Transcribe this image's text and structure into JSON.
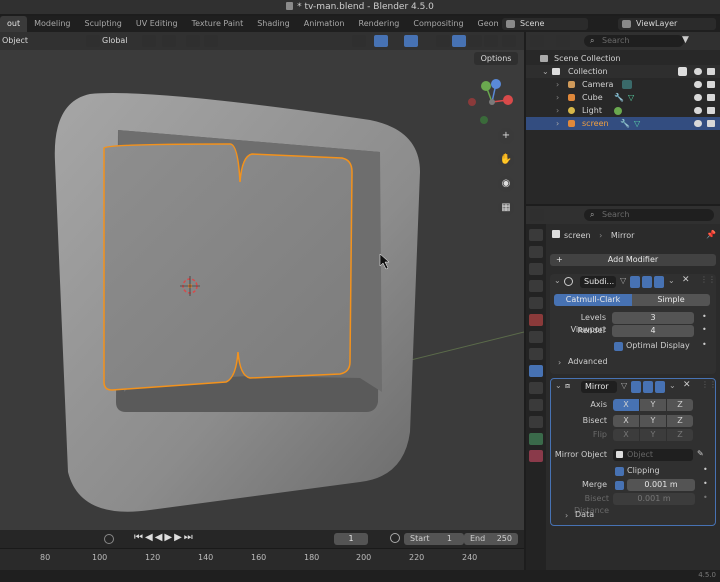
{
  "window": {
    "title": "* tv-man.blend - Blender 4.5.0"
  },
  "workspace_tabs": [
    "out",
    "Modeling",
    "Sculpting",
    "UV Editing",
    "Texture Paint",
    "Shading",
    "Animation",
    "Rendering",
    "Compositing",
    "Geometry Nodes",
    "Sc"
  ],
  "scene": {
    "name": "Scene",
    "view_layer": "ViewLayer"
  },
  "viewport": {
    "mode": "Object",
    "orientation": "Global",
    "options_label": "Options"
  },
  "timeline": {
    "current_frame": "1",
    "start_label": "Start",
    "start": "1",
    "end_label": "End",
    "end": "250",
    "ruler": [
      "80",
      "100",
      "120",
      "140",
      "160",
      "180",
      "200",
      "220",
      "240"
    ]
  },
  "version": "4.5.0",
  "outliner": {
    "search_placeholder": "Search",
    "scene_collection": "Scene Collection",
    "collection": "Collection",
    "items": [
      {
        "name": "Camera",
        "color": "#d09a5a"
      },
      {
        "name": "Cube",
        "color": "#e0883a"
      },
      {
        "name": "Light",
        "color": "#d8b84a"
      },
      {
        "name": "screen",
        "color": "#e0883a"
      }
    ]
  },
  "properties": {
    "search_placeholder": "Search",
    "object_name": "screen",
    "modifier_breadcrumb": "Mirror",
    "add_modifier": "Add Modifier",
    "subdiv": {
      "name": "Subdi...",
      "method_catmull": "Catmull-Clark",
      "method_simple": "Simple",
      "levels_viewport_label": "Levels Viewport",
      "levels_viewport": "3",
      "render_label": "Render",
      "render": "4",
      "optimal_display": "Optimal Display",
      "advanced": "Advanced"
    },
    "mirror": {
      "name": "Mirror",
      "axis_label": "Axis",
      "bisect_label": "Bisect",
      "flip_label": "Flip",
      "x": "X",
      "y": "Y",
      "z": "Z",
      "mirror_object_label": "Mirror Object",
      "mirror_object_placeholder": "Object",
      "clipping": "Clipping",
      "merge_label": "Merge",
      "merge_value": "0.001 m",
      "bisect_distance_label": "Bisect Distance",
      "bisect_distance": "0.001 m",
      "data": "Data"
    }
  }
}
